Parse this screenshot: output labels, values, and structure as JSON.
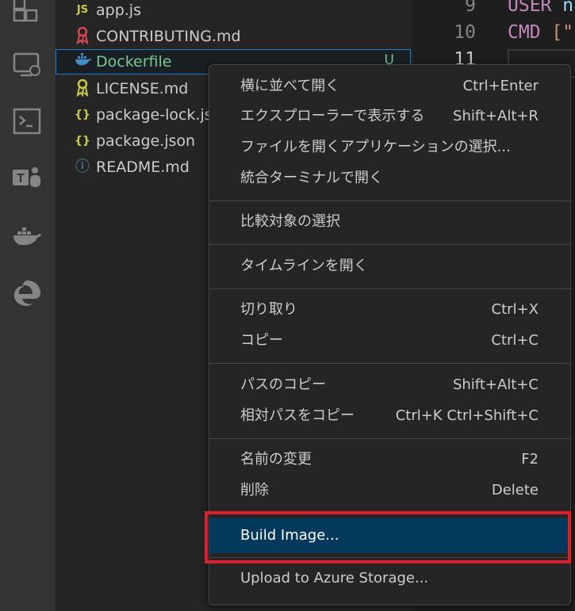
{
  "explorer": {
    "files": [
      {
        "name": "app.js",
        "icon": "js-icon",
        "glyph": "JS"
      },
      {
        "name": "CONTRIBUTING.md",
        "icon": "ribbon-icon",
        "glyph": ""
      },
      {
        "name": "Dockerfile",
        "icon": "docker-icon",
        "glyph": "",
        "selected": true,
        "badge": "U"
      },
      {
        "name": "LICENSE.md",
        "icon": "license-icon",
        "glyph": ""
      },
      {
        "name": "package-lock.jso",
        "icon": "json-icon",
        "glyph": "{}"
      },
      {
        "name": "package.json",
        "icon": "json-icon",
        "glyph": "{}"
      },
      {
        "name": "README.md",
        "icon": "info-icon",
        "glyph": "ⓘ"
      }
    ]
  },
  "editor": {
    "lines": [
      {
        "num": "9",
        "keyword": "USER",
        "rest": "n"
      },
      {
        "num": "10",
        "keyword": "CMD",
        "rest": "[\""
      },
      {
        "num": "11",
        "keyword": "",
        "rest": ""
      }
    ]
  },
  "menu": {
    "items": [
      {
        "label": "横に並べて開く",
        "shortcut": "Ctrl+Enter"
      },
      {
        "label": "エクスプローラーで表示する",
        "shortcut": "Shift+Alt+R"
      },
      {
        "label": "ファイルを開くアプリケーションの選択...",
        "shortcut": ""
      },
      {
        "label": "統合ターミナルで開く",
        "shortcut": ""
      },
      {
        "label": "比較対象の選択",
        "shortcut": ""
      },
      {
        "label": "タイムラインを開く",
        "shortcut": ""
      },
      {
        "label": "切り取り",
        "shortcut": "Ctrl+X"
      },
      {
        "label": "コピー",
        "shortcut": "Ctrl+C"
      },
      {
        "label": "パスのコピー",
        "shortcut": "Shift+Alt+C"
      },
      {
        "label": "相対パスをコピー",
        "shortcut": "Ctrl+K Ctrl+Shift+C"
      },
      {
        "label": "名前の変更",
        "shortcut": "F2"
      },
      {
        "label": "削除",
        "shortcut": "Delete"
      },
      {
        "label": "Build Image...",
        "shortcut": ""
      },
      {
        "label": "Upload to Azure Storage...",
        "shortcut": ""
      }
    ]
  },
  "colors": {
    "highlight": "#e01e2c",
    "menu_active": "#04395e",
    "git_untracked": "#73c991"
  }
}
